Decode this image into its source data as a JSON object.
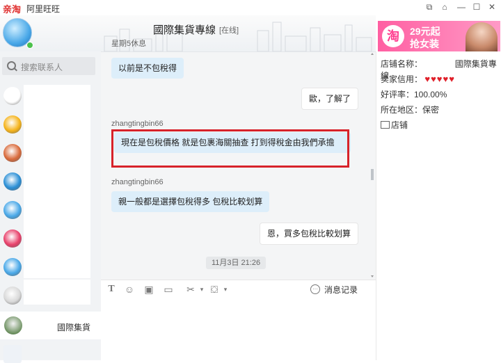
{
  "titlebar": {
    "brand": "亲淘",
    "app_name": "阿里旺旺",
    "icons": [
      "pin-icon",
      "home-icon",
      "minimize-icon",
      "maximize-icon",
      "close-icon"
    ]
  },
  "header": {
    "contact_name": "國際集貨專線",
    "status": "[在线]",
    "subtitle": "星期5休息"
  },
  "ad": {
    "logo": "淘",
    "line1": "29元起",
    "line2": "抢女装"
  },
  "sidebar": {
    "search_placeholder": "搜索联系人",
    "selected_contact": "國際集貨",
    "avatar_colors": [
      "#ffffff",
      "#f5b31a",
      "#d96a3b",
      "#2a8fd6",
      "#49a8e8",
      "#e8406a",
      "#49a8e8",
      "#d9d9d9"
    ]
  },
  "messages": [
    {
      "dir": "in",
      "sender": "",
      "text": "以前是不包稅得"
    },
    {
      "dir": "out",
      "sender": "",
      "text": "歐，了解了"
    },
    {
      "dir": "in",
      "sender": "zhangtingbin66",
      "text": "現在是包稅價格   就是包裹海關抽查 打到得稅金由我們承擔"
    },
    {
      "dir": "in",
      "sender": "zhangtingbin66",
      "text": "親一般都是選擇包稅得多  包稅比較划算"
    },
    {
      "dir": "out",
      "sender": "",
      "text": "恩，買多包稅比較划算"
    }
  ],
  "timestamp": "11月3日 21:26",
  "toolbar": {
    "history_label": "消息记录",
    "icons": [
      "text-format-icon",
      "emoji-icon",
      "image-icon",
      "screenshot-icon",
      "scissors-icon",
      "shake-icon"
    ]
  },
  "shop_info": {
    "name_label": "店铺名称：",
    "name_value": "國際集貨專線",
    "credit_label": "卖家信用：",
    "hearts": 5,
    "rate_label": "好评率：100.00%",
    "region_label": "所在地区：保密",
    "shop_link": "店铺"
  }
}
